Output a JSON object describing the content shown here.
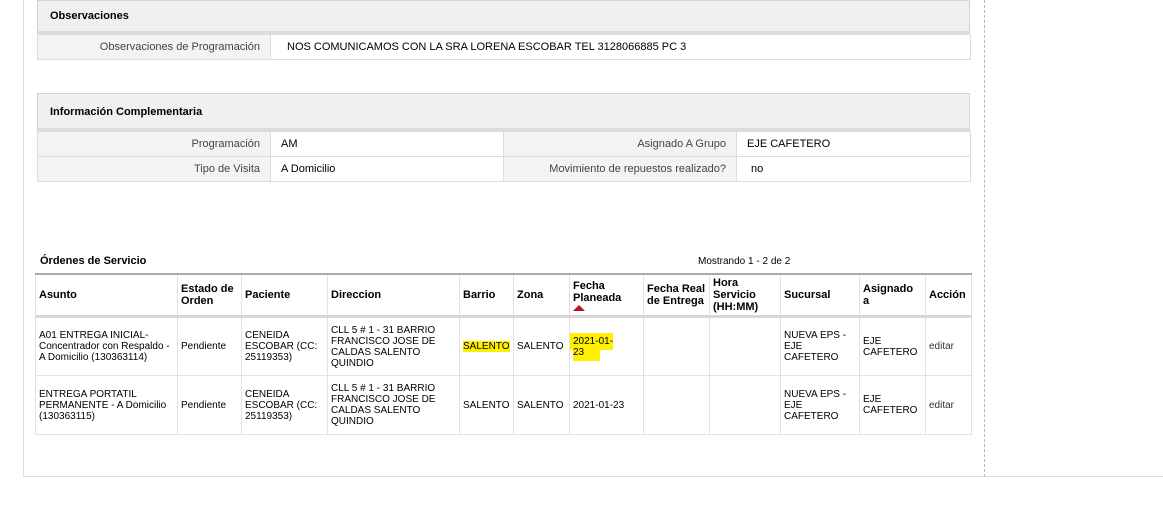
{
  "observaciones": {
    "title": "Observaciones",
    "label": "Observaciones de Programación",
    "value": "NOS COMUNICAMOS CON LA SRA LORENA ESCOBAR TEL 3128066885 PC 3"
  },
  "info": {
    "title": "Información Complementaria",
    "programacion_label": "Programación",
    "programacion_value": "AM",
    "grupo_label": "Asignado A Grupo",
    "grupo_value": "EJE CAFETERO",
    "visita_label": "Tipo de Visita",
    "visita_value": "A Domicilio",
    "repuestos_label": "Movimiento de repuestos realizado?",
    "repuestos_value": "no"
  },
  "ordenes": {
    "title": "Órdenes de Servicio",
    "showing": "Mostrando 1 - 2 de 2",
    "headers": {
      "asunto": "Asunto",
      "estado": "Estado de Orden",
      "paciente": "Paciente",
      "direccion": "Direccion",
      "barrio": "Barrio",
      "zona": "Zona",
      "fecha_planeada": "Fecha Planeada",
      "fecha_real": "Fecha Real de Entrega",
      "hora": "Hora Servicio (HH:MM)",
      "sucursal": "Sucursal",
      "asignado": "Asignado a",
      "accion": "Acción"
    },
    "rows": [
      {
        "asunto": "A01 ENTREGA INICIAL-Concentrador con Respaldo - A Domicilio (130363114)",
        "estado": "Pendiente",
        "paciente": "CENEIDA ESCOBAR (CC: 25119353)",
        "direccion": "CLL 5 # 1 - 31 BARRIO FRANCISCO JOSE DE CALDAS SALENTO QUINDIO",
        "barrio": "SALENTO",
        "zona": "SALENTO",
        "fecha_planeada": "2021-01-23",
        "fecha_real": "",
        "hora": "",
        "sucursal": "NUEVA EPS - EJE CAFETERO",
        "asignado": "EJE CAFETERO",
        "accion": "editar"
      },
      {
        "asunto": "ENTREGA PORTATIL PERMANENTE - A Domicilio (130363115)",
        "estado": "Pendiente",
        "paciente": "CENEIDA ESCOBAR (CC: 25119353)",
        "direccion": "CLL 5 # 1 - 31 BARRIO FRANCISCO JOSE DE CALDAS SALENTO QUINDIO",
        "barrio": "SALENTO",
        "zona": "SALENTO",
        "fecha_planeada": "2021-01-23",
        "fecha_real": "",
        "hora": "",
        "sucursal": "NUEVA EPS - EJE CAFETERO",
        "asignado": "EJE CAFETERO",
        "accion": "editar"
      }
    ]
  },
  "colors": {
    "highlight": "#ffef00",
    "sort_arrow": "#b01818"
  }
}
